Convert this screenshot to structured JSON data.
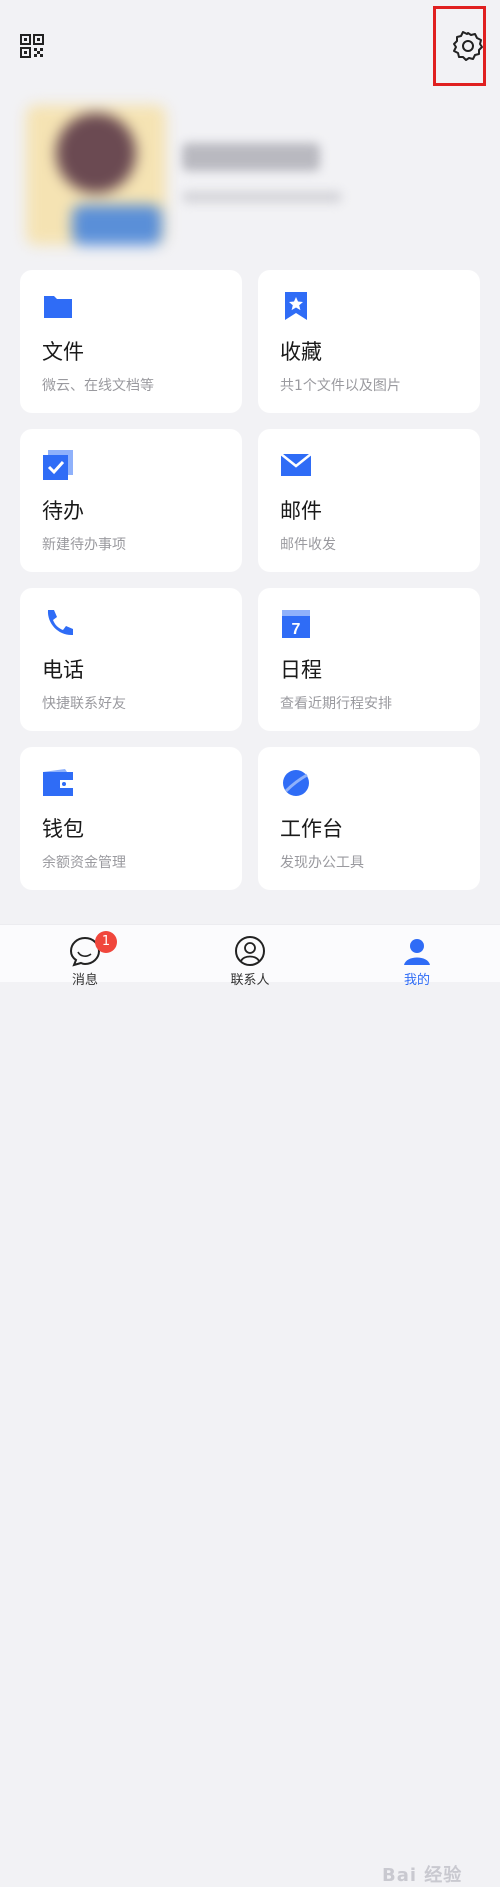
{
  "header": {
    "qr_icon": "qr-code-icon",
    "settings_icon": "gear-icon"
  },
  "colors": {
    "accent": "#2f6cf6",
    "highlight": "#e02020",
    "badge": "#f0463c"
  },
  "grid": {
    "items": [
      {
        "title": "文件",
        "desc": "微云、在线文档等",
        "icon": "folder-icon"
      },
      {
        "title": "收藏",
        "desc": "共1个文件以及图片",
        "icon": "bookmark-star-icon"
      },
      {
        "title": "待办",
        "desc": "新建待办事项",
        "icon": "todo-check-icon"
      },
      {
        "title": "邮件",
        "desc": "邮件收发",
        "icon": "mail-icon"
      },
      {
        "title": "电话",
        "desc": "快捷联系好友",
        "icon": "phone-icon"
      },
      {
        "title": "日程",
        "desc": "查看近期行程安排",
        "icon": "calendar-icon"
      },
      {
        "title": "钱包",
        "desc": "余额资金管理",
        "icon": "wallet-icon"
      },
      {
        "title": "工作台",
        "desc": "发现办公工具",
        "icon": "workbench-planet-icon"
      }
    ]
  },
  "calendar_day": "7",
  "tabbar": {
    "tabs": [
      {
        "label": "消息",
        "badge": "1",
        "icon": "message-icon"
      },
      {
        "label": "联系人",
        "icon": "contacts-icon"
      },
      {
        "label": "我的",
        "icon": "me-icon"
      }
    ]
  },
  "watermark": "Bai 经验"
}
